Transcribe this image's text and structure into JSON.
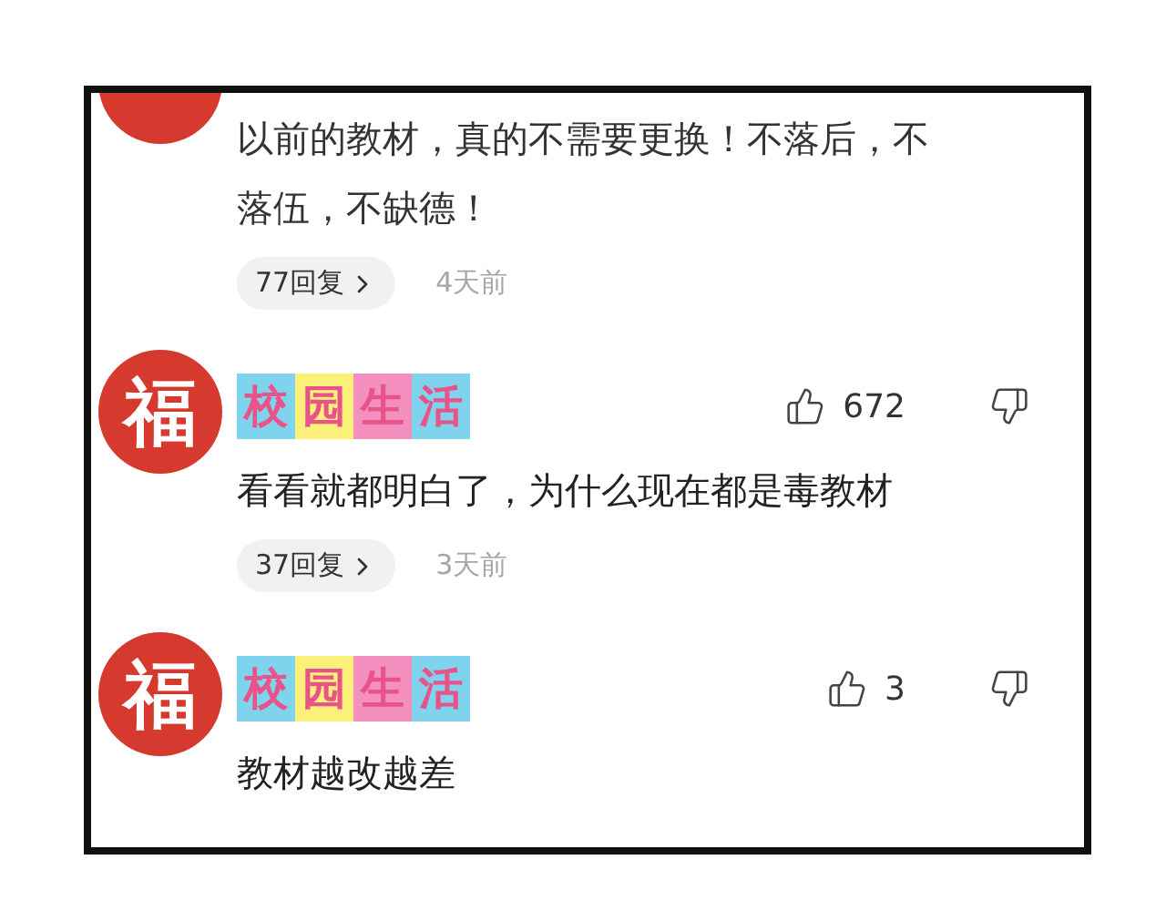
{
  "comments": [
    {
      "kind": "partial",
      "body": "以前的教材，真的不需要更换！不落后，不落伍，不缺德！",
      "replies": "77回复",
      "time": "4天前"
    },
    {
      "kind": "full",
      "avatar": "福",
      "name": "校园生活",
      "likes": "672",
      "body": "看看就都明白了，为什么现在都是毒教材",
      "replies": "37回复",
      "time": "3天前"
    },
    {
      "kind": "full",
      "avatar": "福",
      "name": "校园生活",
      "likes": "3",
      "body": "教材越改越差"
    }
  ]
}
